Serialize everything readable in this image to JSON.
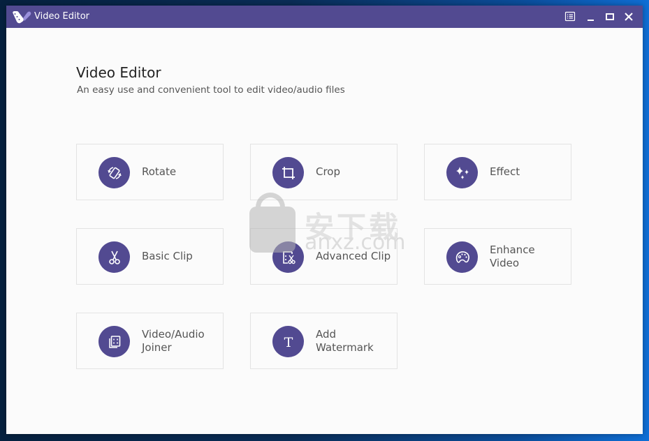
{
  "window": {
    "title": "Video Editor",
    "controls": {
      "menu": "menu-icon",
      "minimize": "minimize-icon",
      "maximize": "maximize-icon",
      "close": "close-icon"
    }
  },
  "header": {
    "title": "Video Editor",
    "subtitle": "An easy use and convenient tool to edit video/audio files"
  },
  "tools": [
    {
      "label": "Rotate",
      "icon": "rotate-icon"
    },
    {
      "label": "Crop",
      "icon": "crop-icon"
    },
    {
      "label": "Effect",
      "icon": "sparkle-icon"
    },
    {
      "label": "Basic Clip",
      "icon": "scissors-icon"
    },
    {
      "label": "Advanced Clip",
      "icon": "advanced-clip-icon"
    },
    {
      "label": "Enhance Video",
      "icon": "palette-icon"
    },
    {
      "label": "Video/Audio Joiner",
      "icon": "joiner-icon"
    },
    {
      "label": "Add Watermark",
      "icon": "text-icon"
    }
  ],
  "watermark": {
    "cn_text": "安下载",
    "url_text": "anxz.com"
  },
  "colors": {
    "accent": "#524a91",
    "background": "#fbfbfb",
    "card_border": "#e3e3e3",
    "text_label": "#555555"
  }
}
